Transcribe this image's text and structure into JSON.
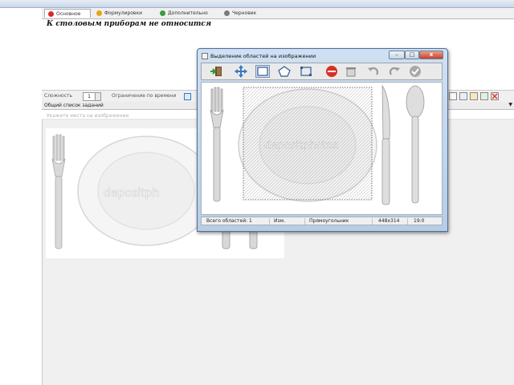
{
  "tabs": [
    {
      "label": "Основное",
      "color": "#d62a2a",
      "active": true
    },
    {
      "label": "Формулировки",
      "color": "#e8a417"
    },
    {
      "label": "Дополнительно",
      "color": "#3a9d3a"
    },
    {
      "label": "Черновик",
      "color": "#7a7a7a"
    }
  ],
  "question": {
    "text": "К столовым приборам не относится"
  },
  "options": {
    "difficulty_label": "Сложность",
    "difficulty_value": "1",
    "time_limit_label": "Ограничение по времени"
  },
  "task_list": {
    "header": "Общий список заданий",
    "placeholder": "Укажите места на изображении"
  },
  "image_panel": {
    "watermark": "depositph"
  },
  "dialog": {
    "title": "Выделение областей на изображении",
    "caption_buttons": {
      "minimize": "–",
      "maximize": "□",
      "close": "x"
    },
    "toolbar_icons": [
      "exit-icon",
      "move-icon",
      "rectangle-icon",
      "polygon-icon",
      "crop-icon",
      "delete-icon",
      "clear-icon",
      "undo-icon",
      "redo-icon",
      "confirm-icon"
    ],
    "watermark": "depositphotos",
    "status": {
      "total_label": "Всего областей: 1",
      "mode": "Изм.",
      "shape": "Прямоугольник",
      "size": "448x314",
      "position": "19:0"
    }
  },
  "colors": {
    "accent": "#3a78c2",
    "title_bar": "#b7cde6",
    "close": "#c8402b"
  }
}
